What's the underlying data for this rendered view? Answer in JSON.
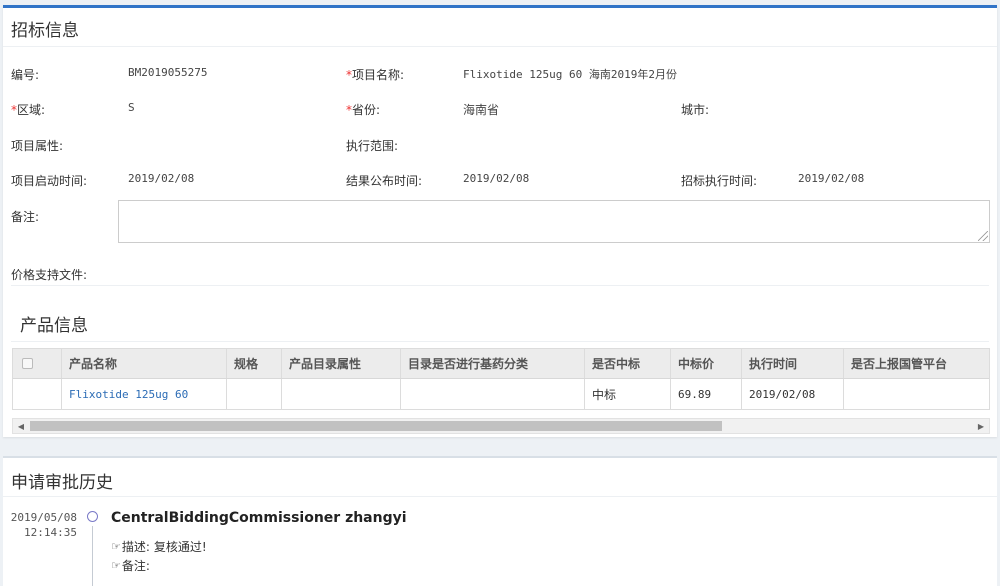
{
  "bid_panel": {
    "title": "招标信息",
    "fields": {
      "code_label": "编号:",
      "code_value": "BM2019055275",
      "project_label": "项目名称:",
      "project_value": "Flixotide 125ug 60 海南2019年2月份",
      "region_label": "区域:",
      "region_value": "S",
      "province_label": "省份:",
      "province_value": "海南省",
      "city_label": "城市:",
      "attr_label": "项目属性:",
      "scope_label": "执行范围:",
      "start_label": "项目启动时间:",
      "start_value": "2019/02/08",
      "result_label": "结果公布时间:",
      "result_value": "2019/02/08",
      "exec_label": "招标执行时间:",
      "exec_value": "2019/02/08",
      "remark_label": "备注:",
      "files_label": "价格支持文件:"
    },
    "required_mark": "*"
  },
  "product_section": {
    "title": "产品信息",
    "columns": [
      "产品名称",
      "规格",
      "产品目录属性",
      "目录是否进行基药分类",
      "是否中标",
      "中标价",
      "执行时间",
      "是否上报国管平台"
    ],
    "rows": [
      {
        "name": "Flixotide 125ug 60",
        "spec": "",
        "catalog_attr": "",
        "essential": "",
        "won": "中标",
        "price": "69.89",
        "exec_time": "2019/02/08",
        "reported": ""
      }
    ]
  },
  "history_panel": {
    "title": "申请审批历史",
    "entries": [
      {
        "date": "2019/05/08",
        "time": "12:14:35",
        "actor": "CentralBiddingCommissioner   zhangyi",
        "desc_label": "描述:",
        "desc_value": "复核通过!",
        "remark_label": "备注:"
      }
    ]
  },
  "icons": {
    "pointer": "hand-point-right-icon",
    "timeline_dot": "circle-icon",
    "scroll_left": "arrow-left-icon",
    "scroll_right": "arrow-right-icon"
  },
  "colors": {
    "accent": "#3174c7",
    "link": "#2a6bb5",
    "required": "#e33333"
  }
}
